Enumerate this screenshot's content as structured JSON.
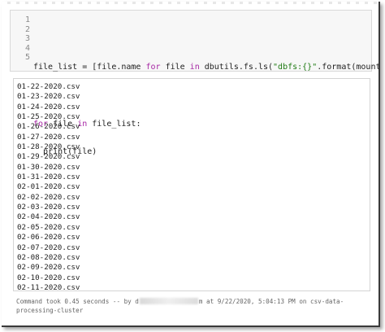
{
  "editor": {
    "line_numbers": [
      "1",
      "2",
      "3",
      "4",
      "5"
    ],
    "line2": {
      "p1": "file_list = [file.name ",
      "kw_for": "for",
      "p2": " file ",
      "kw_in": "in",
      "p3": " dbutils.fs.ls(",
      "str": "\"dbfs:{}\"",
      "p4": ".format(mountPoint))]"
    },
    "line4": {
      "kw_for": "for",
      "p1": " file ",
      "kw_in": "in",
      "p2": " file_list:"
    },
    "line5": "  print(file)"
  },
  "output": {
    "files": [
      "01-22-2020.csv",
      "01-23-2020.csv",
      "01-24-2020.csv",
      "01-25-2020.csv",
      "01-26-2020.csv",
      "01-27-2020.csv",
      "01-28-2020.csv",
      "01-29-2020.csv",
      "01-30-2020.csv",
      "01-31-2020.csv",
      "02-01-2020.csv",
      "02-02-2020.csv",
      "02-03-2020.csv",
      "02-04-2020.csv",
      "02-05-2020.csv",
      "02-06-2020.csv",
      "02-07-2020.csv",
      "02-08-2020.csv",
      "02-09-2020.csv",
      "02-10-2020.csv",
      "02-11-2020.csv"
    ]
  },
  "status": {
    "prefix": "Command took 0.45 seconds -- by d",
    "suffix": "m at 9/22/2020, 5:04:13 PM on csv-data-processing-cluster"
  }
}
